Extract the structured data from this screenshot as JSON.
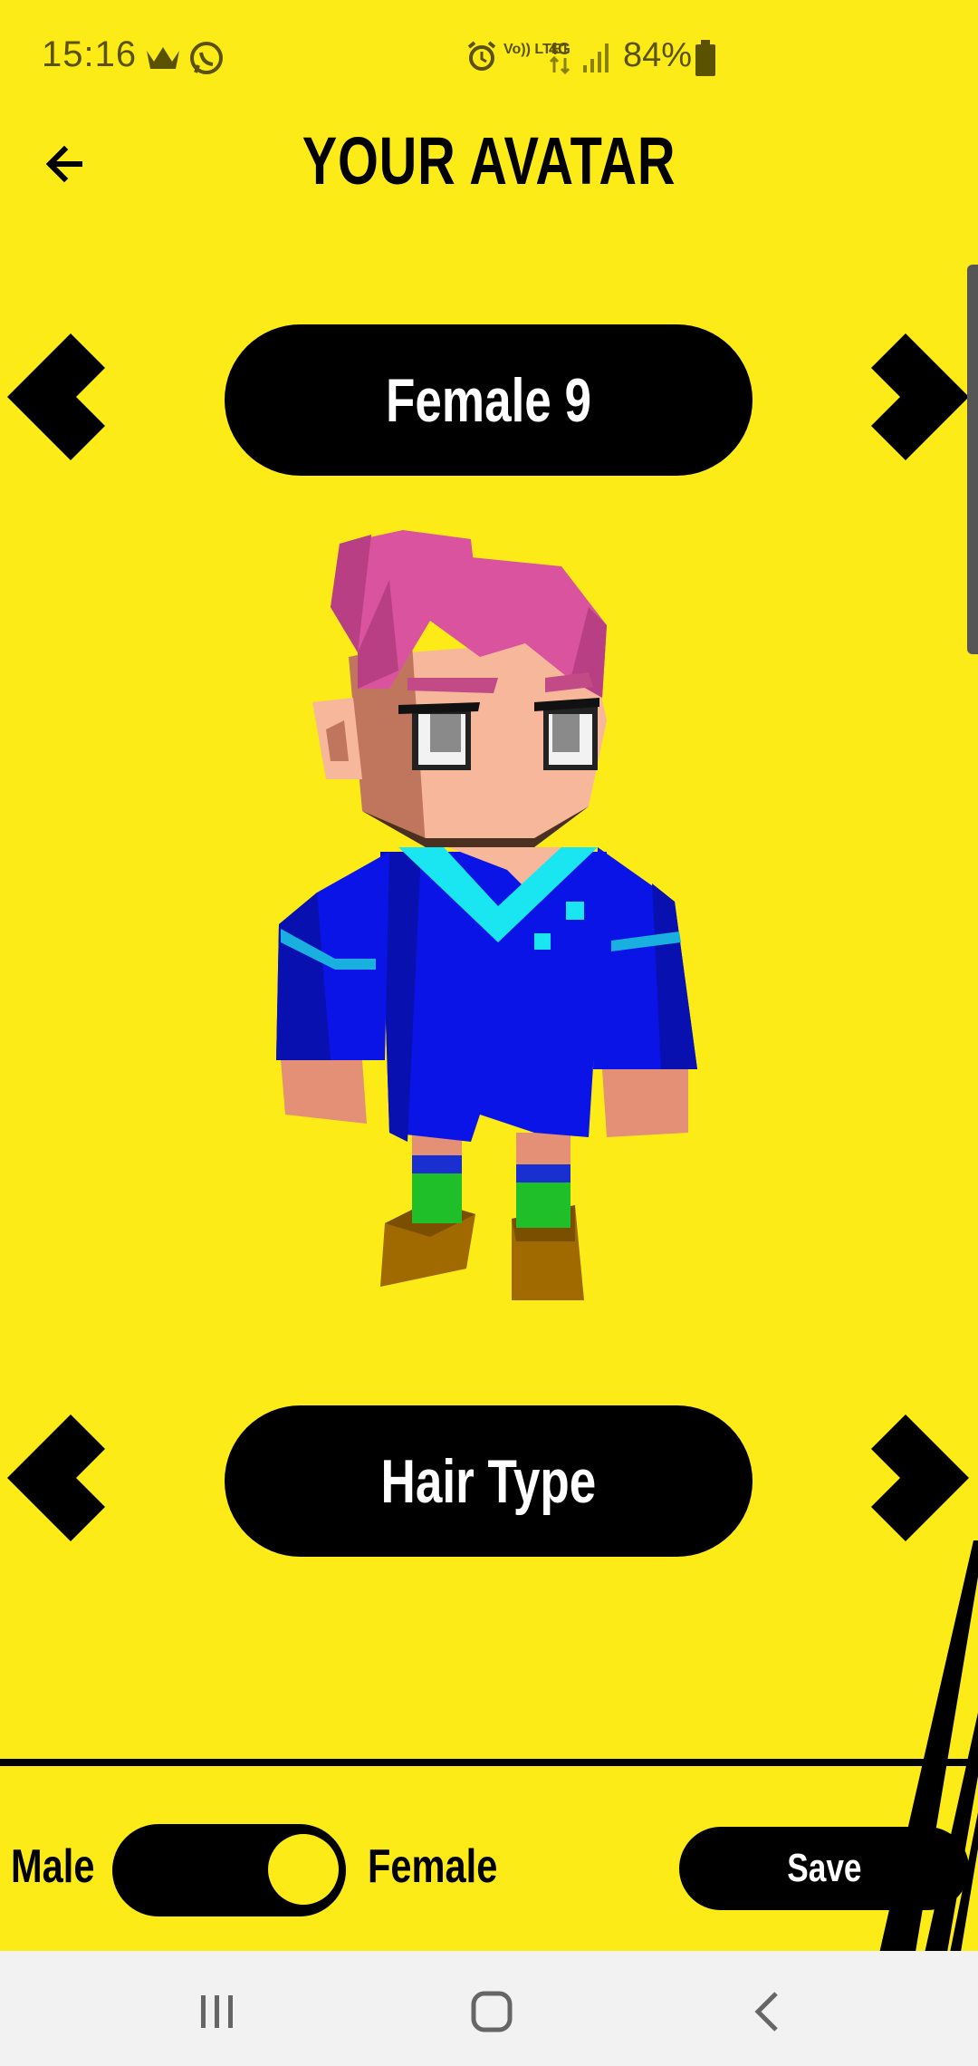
{
  "status_bar": {
    "time": "15:16",
    "network": "Vo)) LTE1",
    "network_type": "4G",
    "battery": "84%"
  },
  "header": {
    "title": "YOUR AVATAR"
  },
  "avatar_selector": {
    "name": "Female 9"
  },
  "category_selector": {
    "name": "Hair Type"
  },
  "gender_toggle": {
    "left_label": "Male",
    "right_label": "Female",
    "selected": "Female"
  },
  "save_button": {
    "label": "Save"
  },
  "colors": {
    "background": "#FCEB17",
    "pill": "#000000",
    "hair": "#D9539E",
    "shirt": "#0A14E6",
    "accent": "#19E6F0",
    "socks": "#1FBF2A",
    "shoes": "#A06A00"
  },
  "icons": {
    "back": "back-arrow-icon",
    "prev": "chevron-left-icon",
    "next": "chevron-right-icon",
    "nav_recents": "recents-icon",
    "nav_home": "home-icon",
    "nav_back": "nav-back-icon"
  }
}
